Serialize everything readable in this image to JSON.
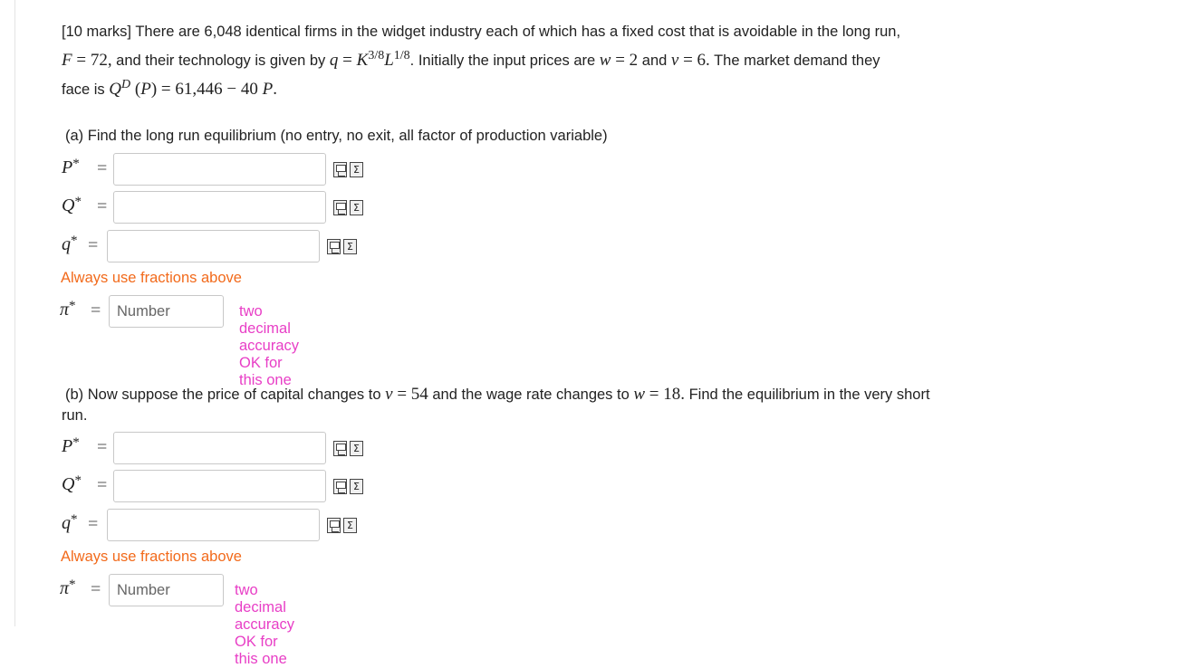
{
  "question": {
    "marks": "[10 marks]",
    "intro_1": " There are 6,048 identical firms in the widget industry each of which has a fixed cost that is avoidable in the long run,",
    "F_sym": "F",
    "F_val": " = 72,",
    "intro_2": " and their technology is given by ",
    "q_sym": "q",
    "q_eq": " = ",
    "K_sym": "K",
    "K_exp": "3/8",
    "L_sym": "L",
    "L_exp": "1/8",
    "intro_3": ". Initially the input prices are ",
    "w_sym": "w",
    "w_val": " = 2",
    "and_1": " and ",
    "v_sym": "v",
    "v_val": " = 6.",
    "intro_4": " The market demand they",
    "intro_5": "face is ",
    "Q_sym": "Q",
    "Q_sup": "D",
    "demand_mid": " (",
    "P_sym": "P",
    "demand_rest": ") = 61,446 − 40 ",
    "P_sym_2": "P",
    "period": "."
  },
  "part_a": {
    "label": "(a) Find the long run equilibrium (no entry, no exit, all factor of production variable)",
    "rows": [
      {
        "var": "P",
        "sup": "*",
        "eq": "="
      },
      {
        "var": "Q",
        "sup": "*",
        "eq": "="
      },
      {
        "var": "q",
        "sup": "*",
        "eq": "="
      }
    ],
    "fractions_note": "Always use fractions above",
    "pi_var": "π",
    "pi_sup": "*",
    "pi_eq": "=",
    "pi_placeholder": "Number",
    "decimal_note": "two decimal accuracy OK for this one"
  },
  "part_b": {
    "label_1": "(b) Now suppose the price of capital changes to ",
    "v_sym": "v",
    "v_val": " = 54",
    "label_2": " and the wage rate changes to ",
    "w_sym": "w",
    "w_val": " = 18.",
    "label_3": " Find the equilibrium in the very short",
    "label_4": "run.",
    "rows": [
      {
        "var": "P",
        "sup": "*",
        "eq": "="
      },
      {
        "var": "Q",
        "sup": "*",
        "eq": "="
      },
      {
        "var": "q",
        "sup": "*",
        "eq": "="
      }
    ],
    "fractions_note": "Always use fractions above",
    "pi_var": "π",
    "pi_sup": "*",
    "pi_eq": "=",
    "pi_placeholder": "Number",
    "decimal_note": "two decimal accuracy OK for this one"
  },
  "icons": {
    "preview": "preview-icon",
    "equation_editor": "equation-editor-icon",
    "sigma_glyph": "Σ"
  },
  "colors": {
    "fractions_note": "#f26a1b",
    "decimal_note": "#e83ec6"
  }
}
